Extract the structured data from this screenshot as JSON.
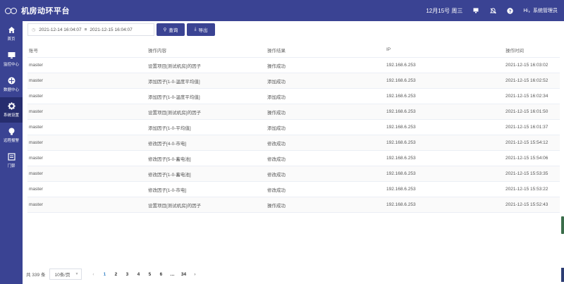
{
  "app": {
    "title": "机房动环平台"
  },
  "header": {
    "date": "12月15号 周三",
    "user": "Hi，系统管理员"
  },
  "sidebar": {
    "items": [
      {
        "label": "首页",
        "icon": "home-icon"
      },
      {
        "label": "监控中心",
        "icon": "monitor-icon"
      },
      {
        "label": "数据中心",
        "icon": "data-icon"
      },
      {
        "label": "系统设置",
        "icon": "gear-icon"
      },
      {
        "label": "远程报警",
        "icon": "alarm-icon"
      },
      {
        "label": "门禁",
        "icon": "door-icon"
      }
    ],
    "active_index": 3
  },
  "filter": {
    "start": "2021-12-14 16:04:07",
    "end": "2021-12-15 16:04:07",
    "query_label": "查询",
    "export_label": "导出"
  },
  "table": {
    "columns": [
      "账号",
      "操作内容",
      "操作结果",
      "IP",
      "操作时间"
    ],
    "rows": [
      [
        "master",
        "设置项目[测试机房]的因子",
        "操作成功",
        "192.168.6.253",
        "2021-12-15 16:03:02"
      ],
      [
        "master",
        "添加因子[1-0-温度平均值]",
        "添加成功",
        "192.168.6.253",
        "2021-12-15 16:02:52"
      ],
      [
        "master",
        "添加因子[1-0-温度平均值]",
        "添加成功",
        "192.168.6.253",
        "2021-12-15 16:02:34"
      ],
      [
        "master",
        "设置项目[测试机房]的因子",
        "操作成功",
        "192.168.6.253",
        "2021-12-15 16:01:50"
      ],
      [
        "master",
        "添加因子[1-0-平均值]",
        "添加成功",
        "192.168.6.253",
        "2021-12-15 16:01:37"
      ],
      [
        "master",
        "修改因子[4-0-市电]",
        "修改成功",
        "192.168.6.253",
        "2021-12-15 15:54:12"
      ],
      [
        "master",
        "修改因子[5-0-蓄电池]",
        "修改成功",
        "192.168.6.253",
        "2021-12-15 15:54:06"
      ],
      [
        "master",
        "修改因子[1-0-蓄电池]",
        "修改成功",
        "192.168.6.253",
        "2021-12-15 15:53:35"
      ],
      [
        "master",
        "修改因子[1-0-市电]",
        "修改成功",
        "192.168.6.253",
        "2021-12-15 15:53:22"
      ],
      [
        "master",
        "设置项目[测试机房]的因子",
        "操作成功",
        "192.168.6.253",
        "2021-12-15 15:52:43"
      ]
    ]
  },
  "pagination": {
    "total": "共 339 条",
    "page_size": "10条/页",
    "prev": "‹",
    "next": "›",
    "pages": [
      "1",
      "2",
      "3",
      "4",
      "5",
      "6",
      "…",
      "34"
    ],
    "current": "1"
  }
}
